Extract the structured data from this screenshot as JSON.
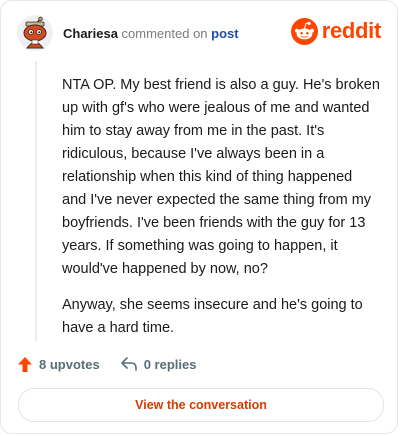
{
  "header": {
    "username": "Chariesa",
    "action_text": "commented on",
    "post_link": "post"
  },
  "brand": {
    "wordmark": "reddit",
    "color": "#ff4500"
  },
  "comment": {
    "paragraphs": [
      "NTA OP. My best friend is also a guy. He's broken up with gf's who were jealous of me and wanted him to stay away from me in the past. It's ridiculous, because I've always been in a relationship when this kind of thing happened and I've never expected the same thing from my boyfriends. I've been friends with the guy for 13 years. If something was going to happen, it would've happened by now, no?",
      "Anyway, she seems insecure and he's going to have a hard time."
    ]
  },
  "footer": {
    "upvotes_label": "8 upvotes",
    "replies_label": "0 replies"
  },
  "cta": {
    "label": "View the conversation"
  },
  "icons": {
    "avatar": "snoo-avatar-icon",
    "logo": "reddit-snoo-icon",
    "upvote": "upvote-arrow-icon",
    "reply": "reply-arrow-icon"
  }
}
